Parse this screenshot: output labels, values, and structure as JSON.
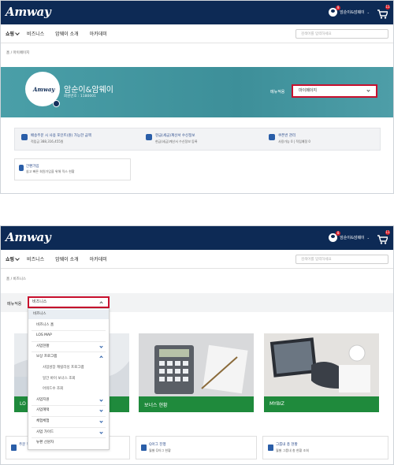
{
  "brand": "Amway",
  "user": {
    "name": "암순이&암웨이",
    "notif_count": "8",
    "cart_count": "11"
  },
  "nav": {
    "items": [
      "쇼핑",
      "비즈니스",
      "암웨이 소개",
      "아카데미"
    ]
  },
  "panel1": {
    "search_placeholder": "검색어를 입력하세요",
    "breadcrumb": "홈  /  마이페이지",
    "avatar_logo": "Amway",
    "profile": {
      "name": "암순이&암웨이",
      "number": "회원번호 : 1180001"
    },
    "menu_label": "메뉴적용",
    "menu_value": "마이페이지",
    "stats": [
      {
        "icon": "coin-icon",
        "title": "배송주문 시 사용 포인트(원) 가능한 금액",
        "sub": "적립금 388,316,455원"
      },
      {
        "icon": "receipt-icon",
        "title": "현금(세금)계산서 수신정보",
        "sub": "현금(세금)계산서 수신정보 등록"
      },
      {
        "icon": "coupon-icon",
        "title": "쿠폰번 관리",
        "sub": "사용가능 0  |  적립예정 0"
      }
    ],
    "consult": {
      "title": "간편가입",
      "sub": "쉽고 빠른 회원가입을 위해 믹스 현황"
    }
  },
  "panel2": {
    "search_placeholder": "검색어를 입력하세요",
    "breadcrumb": "홈  /  비즈니스",
    "menu_label": "메뉴적용",
    "dropdown_value": "비즈니스",
    "dropdown_items": [
      {
        "label": "비즈니스",
        "kind": "head"
      },
      {
        "label": "비즈니스 홈",
        "kind": "item"
      },
      {
        "label": "LOS MAP",
        "kind": "item"
      },
      {
        "label": "사업현황",
        "kind": "item",
        "chevron": "down"
      },
      {
        "label": "보상 프로그램",
        "kind": "item",
        "chevron": "up"
      },
      {
        "label": "사업성장 캐릴리싱 프로그램",
        "kind": "sub"
      },
      {
        "label": "일간 바이 보너스 조회",
        "kind": "sub"
      },
      {
        "label": "어워드수 조회",
        "kind": "sub"
      },
      {
        "label": "사업지원",
        "kind": "item",
        "chevron": "down"
      },
      {
        "label": "사업혜택",
        "kind": "item",
        "chevron": "down"
      },
      {
        "label": "체험체험",
        "kind": "item",
        "chevron": "down"
      },
      {
        "label": "사업 가이드",
        "kind": "item",
        "chevron": "down"
      },
      {
        "label": "뉴편 선원자",
        "kind": "item"
      }
    ],
    "cards": [
      {
        "label": "LO",
        "image": "handshake-photo"
      },
      {
        "label": "보너스 현황",
        "image": "calculator-photo"
      },
      {
        "label": "MYBIZ",
        "image": "desk-photo"
      }
    ],
    "bottom_boxes": [
      {
        "title": "주문 목록",
        "sub": ""
      },
      {
        "title": "Q아그 진행",
        "sub": "월별 Q아그 현황"
      },
      {
        "title": "그룹내 총 현황",
        "sub": "월별 그룹내 총 현황 조회"
      }
    ]
  }
}
